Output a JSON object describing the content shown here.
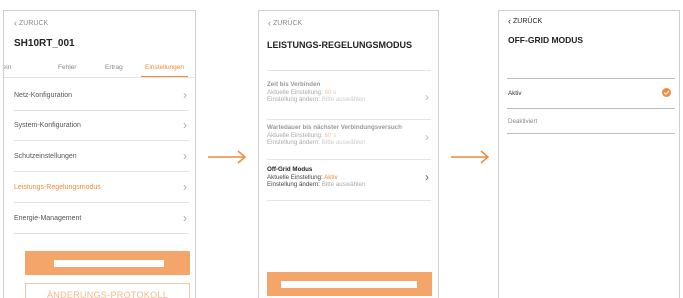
{
  "screen1": {
    "back_label": "ZURÜCK",
    "device_name": "SH10RT_001",
    "tabs": [
      "gemein",
      "Fehler",
      "Ertrag",
      "Einstellungen"
    ],
    "menu_items": [
      "Netz-Konfiguration",
      "System-Konfiguration",
      "Schutzeinstellungen",
      "Leistungs-Regelungsmodus",
      "Energie-Management"
    ],
    "log_button": "ÄNDERUNGS-PROTOKOLL"
  },
  "screen2": {
    "back_label": "ZURÜCK",
    "title": "LEISTUNGS-REGELUNGSMODUS",
    "items": [
      {
        "title": "Zeit bis Verbinden",
        "current_label": "Aktuelle Einstellung:",
        "current_value": "60 s",
        "change_label": "Einstellung ändern:",
        "change_hint": "Bitte auswählen"
      },
      {
        "title": "Wartedauer bis nächster Verbindungsversuch",
        "current_label": "Aktuelle Einstellung:",
        "current_value": "60 s",
        "change_label": "Einstellung ändern:",
        "change_hint": "Bitte auswählen"
      },
      {
        "title": "Off-Grid Modus",
        "current_label": "Aktuelle Einstellung:",
        "current_value": "Aktiv",
        "change_label": "Einstellung ändern:",
        "change_hint": "Bitte auswählen"
      }
    ]
  },
  "screen3": {
    "back_label": "ZURÜCK",
    "title": "OFF-GRID MODUS",
    "options": [
      "Aktiv",
      "Deaktiviert"
    ],
    "selected": "Aktiv"
  },
  "colors": {
    "accent": "#f08a3c",
    "accent_light": "#f4a56a"
  }
}
